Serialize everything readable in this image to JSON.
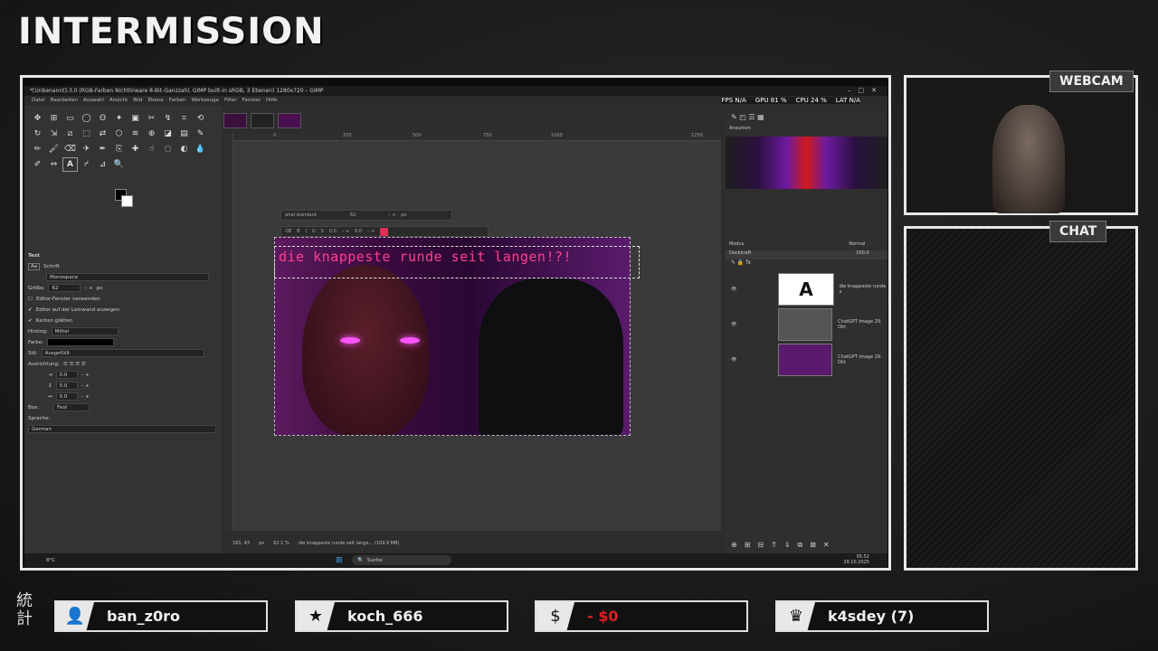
{
  "overlay": {
    "title": "INTERMISSION",
    "webcam_label": "WEBCAM",
    "chat_label": "CHAT",
    "kanji": "統計"
  },
  "gimp": {
    "window_title": "*[Unbenannt]-3.0 (RGB-Farben Nichtlineare 8-Bit-Ganzzahl, GIMP built-in sRGB, 3 Ebenen) 1280x720 – GIMP",
    "stats": {
      "fps": "FPS N/A",
      "gpu": "GPU 81 %",
      "cpu": "CPU 24 %",
      "lat": "LAT N/A"
    },
    "menu": [
      "Datei",
      "Bearbeiten",
      "Auswahl",
      "Ansicht",
      "Bild",
      "Ebene",
      "Farben",
      "Werkzeuge",
      "Filter",
      "Fenster",
      "Hilfe"
    ],
    "ruler_ticks": [
      "0",
      "250",
      "500",
      "750",
      "1000",
      "1250"
    ],
    "tool_options": {
      "heading": "Text",
      "font_label": "Schrift",
      "font_value": "Monospace",
      "size_label": "Größe:",
      "size_value": "62",
      "size_unit": "px",
      "editor_window": "Editor-Fenster verwenden",
      "editor_canvas": "Editor auf der Leinwand anzeigen",
      "antialias": "Kanten glätten",
      "hinting_label": "Hinting:",
      "hinting_value": "Mittel",
      "color_label": "Farbe:",
      "style_label": "Stil:",
      "style_value": "Ausgefüllt",
      "justify_label": "Ausrichtung:",
      "indent": "0.0",
      "spacing": "0.0",
      "letter": "0.0",
      "box_label": "Box:",
      "box_value": "Fest",
      "lang_label": "Sprache:",
      "lang_value": "German"
    },
    "text_toolbar": {
      "font": "arial standard",
      "size": "62",
      "unit": "px",
      "baseline": "0.0",
      "kerning": "0.0"
    },
    "canvas_text": "die knappeste runde seit langen!?!",
    "status": {
      "coords": "181, 43",
      "unit": "px",
      "zoom": "62.1 %",
      "info": "die knappeste runde seit lange... (109.9 MB)"
    },
    "gradient_name": "Aneurism",
    "layers_panel": {
      "mode_label": "Modus",
      "mode_value": "Normal",
      "opacity_label": "Deckkraft",
      "opacity_value": "100.0",
      "layers": [
        {
          "name": "die knappeste runde s"
        },
        {
          "name": "ChatGPT Image 29. Okt"
        },
        {
          "name": "ChatGPT Image 29. Okt"
        }
      ]
    },
    "taskbar": {
      "weather": "8°C",
      "search": "Suche",
      "time": "05:52",
      "date": "29.10.2025"
    }
  },
  "bottom": [
    {
      "icon": "user-add-icon",
      "glyph": "👤",
      "label": "ban_z0ro"
    },
    {
      "icon": "star-icon",
      "glyph": "★",
      "label": "koch_666"
    },
    {
      "icon": "dollar-icon",
      "glyph": "$",
      "label": "- $0"
    },
    {
      "icon": "crown-icon",
      "glyph": "♛",
      "label": "k4sdey (7)"
    }
  ],
  "colors": {
    "accent": "#ff3f8e",
    "frame": "#e8e8e8"
  }
}
